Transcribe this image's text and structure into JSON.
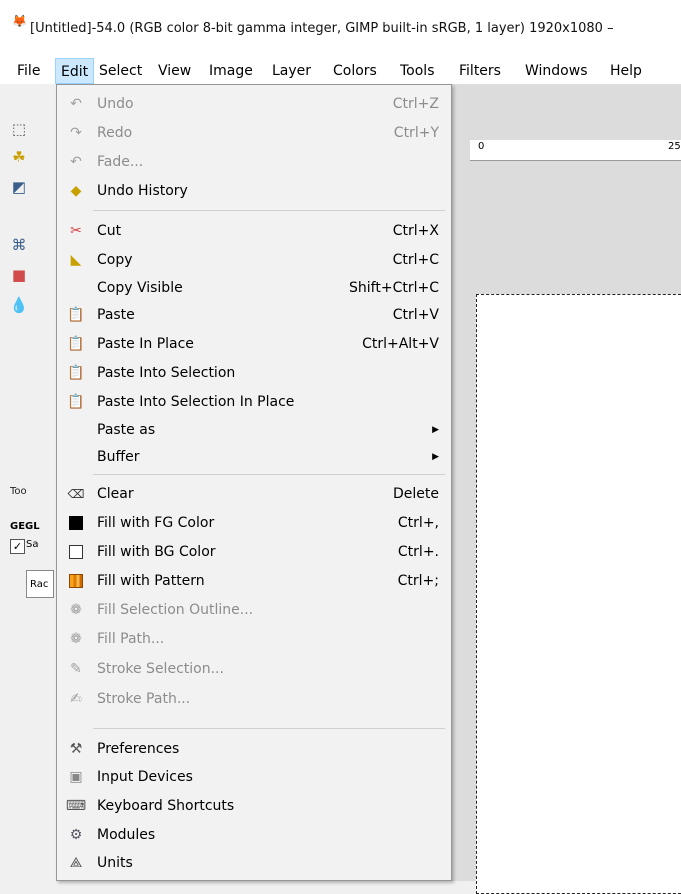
{
  "window": {
    "title": "[Untitled]-54.0 (RGB color 8-bit gamma integer, GIMP built-in sRGB, 1 layer) 1920x1080 –",
    "icon": "wilber-icon"
  },
  "menubar": {
    "items": [
      {
        "label": "File"
      },
      {
        "label": "Edit"
      },
      {
        "label": "Select"
      },
      {
        "label": "View"
      },
      {
        "label": "Image"
      },
      {
        "label": "Layer"
      },
      {
        "label": "Colors"
      },
      {
        "label": "Tools"
      },
      {
        "label": "Filters"
      },
      {
        "label": "Windows"
      },
      {
        "label": "Help"
      }
    ],
    "active": "Edit"
  },
  "toolbox": {
    "panel_tab": "Too",
    "gegl_label": "GEGL",
    "checkbox_label": "Sa",
    "radius_label": "Rac"
  },
  "ruler": {
    "start": "0",
    "end": "25"
  },
  "edit_menu": {
    "items": [
      {
        "label": "Undo",
        "shortcut": "Ctrl+Z",
        "disabled": true,
        "icon": "undo-icon"
      },
      {
        "label": "Redo",
        "shortcut": "Ctrl+Y",
        "disabled": true,
        "icon": "redo-icon"
      },
      {
        "label": "Fade...",
        "shortcut": "",
        "disabled": true,
        "icon": "fade-icon"
      },
      {
        "label": "Undo History",
        "shortcut": "",
        "disabled": false,
        "icon": "undo-history-icon"
      },
      {
        "label": "Cut",
        "shortcut": "Ctrl+X",
        "disabled": false,
        "icon": "scissors-icon"
      },
      {
        "label": "Copy",
        "shortcut": "Ctrl+C",
        "disabled": false,
        "icon": "copy-icon"
      },
      {
        "label": "Copy Visible",
        "shortcut": "Shift+Ctrl+C",
        "disabled": false,
        "icon": ""
      },
      {
        "label": "Paste",
        "shortcut": "Ctrl+V",
        "disabled": false,
        "icon": "paste-icon"
      },
      {
        "label": "Paste In Place",
        "shortcut": "Ctrl+Alt+V",
        "disabled": false,
        "icon": "paste-in-place-icon"
      },
      {
        "label": "Paste Into Selection",
        "shortcut": "",
        "disabled": false,
        "icon": "paste-into-icon"
      },
      {
        "label": "Paste Into Selection In Place",
        "shortcut": "",
        "disabled": false,
        "icon": "paste-into-in-place-icon"
      },
      {
        "label": "Paste as",
        "shortcut": "",
        "disabled": false,
        "submenu": true
      },
      {
        "label": "Buffer",
        "shortcut": "",
        "disabled": false,
        "submenu": true
      },
      {
        "label": "Clear",
        "shortcut": "Delete",
        "disabled": false,
        "icon": "clear-icon"
      },
      {
        "label": "Fill with FG Color",
        "shortcut": "Ctrl+,",
        "disabled": false,
        "icon": "fg-swatch-icon"
      },
      {
        "label": "Fill with BG Color",
        "shortcut": "Ctrl+.",
        "disabled": false,
        "icon": "bg-swatch-icon"
      },
      {
        "label": "Fill with Pattern",
        "shortcut": "Ctrl+;",
        "disabled": false,
        "icon": "pattern-icon"
      },
      {
        "label": "Fill Selection Outline...",
        "shortcut": "",
        "disabled": true,
        "icon": "fill-outline-icon"
      },
      {
        "label": "Fill Path...",
        "shortcut": "",
        "disabled": true,
        "icon": "fill-path-icon"
      },
      {
        "label": "Stroke Selection...",
        "shortcut": "",
        "disabled": true,
        "icon": "stroke-selection-icon"
      },
      {
        "label": "Stroke Path...",
        "shortcut": "",
        "disabled": true,
        "icon": "stroke-path-icon"
      },
      {
        "label": "Preferences",
        "shortcut": "",
        "disabled": false,
        "icon": "preferences-icon"
      },
      {
        "label": "Input Devices",
        "shortcut": "",
        "disabled": false,
        "icon": "input-devices-icon"
      },
      {
        "label": "Keyboard Shortcuts",
        "shortcut": "",
        "disabled": false,
        "icon": "keyboard-icon"
      },
      {
        "label": "Modules",
        "shortcut": "",
        "disabled": false,
        "icon": "modules-icon"
      },
      {
        "label": "Units",
        "shortcut": "",
        "disabled": false,
        "icon": "units-icon"
      }
    ]
  },
  "colors": {
    "menu_highlight": "#cce8ff",
    "menu_highlight_border": "#99d1ff",
    "disabled_text": "#8c8c8c",
    "fg_color": "#000000",
    "bg_color": "#ffffff"
  }
}
